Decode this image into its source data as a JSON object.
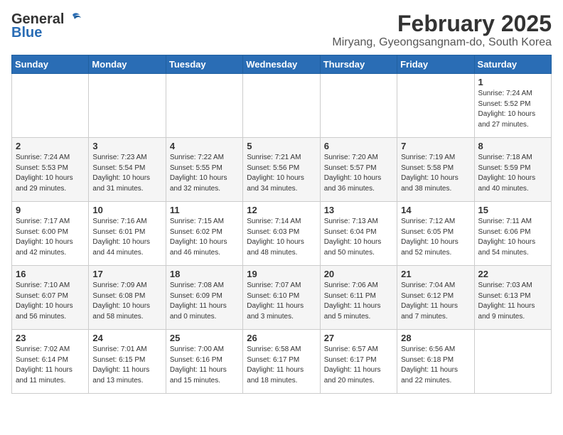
{
  "header": {
    "logo_line1": "General",
    "logo_line2": "Blue",
    "month_title": "February 2025",
    "location": "Miryang, Gyeongsangnam-do, South Korea"
  },
  "weekdays": [
    "Sunday",
    "Monday",
    "Tuesday",
    "Wednesday",
    "Thursday",
    "Friday",
    "Saturday"
  ],
  "weeks": [
    [
      {
        "day": "",
        "sunrise": "",
        "sunset": "",
        "daylight": ""
      },
      {
        "day": "",
        "sunrise": "",
        "sunset": "",
        "daylight": ""
      },
      {
        "day": "",
        "sunrise": "",
        "sunset": "",
        "daylight": ""
      },
      {
        "day": "",
        "sunrise": "",
        "sunset": "",
        "daylight": ""
      },
      {
        "day": "",
        "sunrise": "",
        "sunset": "",
        "daylight": ""
      },
      {
        "day": "",
        "sunrise": "",
        "sunset": "",
        "daylight": ""
      },
      {
        "day": "1",
        "sunrise": "7:24 AM",
        "sunset": "5:52 PM",
        "daylight": "10 hours and 27 minutes."
      }
    ],
    [
      {
        "day": "2",
        "sunrise": "7:24 AM",
        "sunset": "5:53 PM",
        "daylight": "10 hours and 29 minutes."
      },
      {
        "day": "3",
        "sunrise": "7:23 AM",
        "sunset": "5:54 PM",
        "daylight": "10 hours and 31 minutes."
      },
      {
        "day": "4",
        "sunrise": "7:22 AM",
        "sunset": "5:55 PM",
        "daylight": "10 hours and 32 minutes."
      },
      {
        "day": "5",
        "sunrise": "7:21 AM",
        "sunset": "5:56 PM",
        "daylight": "10 hours and 34 minutes."
      },
      {
        "day": "6",
        "sunrise": "7:20 AM",
        "sunset": "5:57 PM",
        "daylight": "10 hours and 36 minutes."
      },
      {
        "day": "7",
        "sunrise": "7:19 AM",
        "sunset": "5:58 PM",
        "daylight": "10 hours and 38 minutes."
      },
      {
        "day": "8",
        "sunrise": "7:18 AM",
        "sunset": "5:59 PM",
        "daylight": "10 hours and 40 minutes."
      }
    ],
    [
      {
        "day": "9",
        "sunrise": "7:17 AM",
        "sunset": "6:00 PM",
        "daylight": "10 hours and 42 minutes."
      },
      {
        "day": "10",
        "sunrise": "7:16 AM",
        "sunset": "6:01 PM",
        "daylight": "10 hours and 44 minutes."
      },
      {
        "day": "11",
        "sunrise": "7:15 AM",
        "sunset": "6:02 PM",
        "daylight": "10 hours and 46 minutes."
      },
      {
        "day": "12",
        "sunrise": "7:14 AM",
        "sunset": "6:03 PM",
        "daylight": "10 hours and 48 minutes."
      },
      {
        "day": "13",
        "sunrise": "7:13 AM",
        "sunset": "6:04 PM",
        "daylight": "10 hours and 50 minutes."
      },
      {
        "day": "14",
        "sunrise": "7:12 AM",
        "sunset": "6:05 PM",
        "daylight": "10 hours and 52 minutes."
      },
      {
        "day": "15",
        "sunrise": "7:11 AM",
        "sunset": "6:06 PM",
        "daylight": "10 hours and 54 minutes."
      }
    ],
    [
      {
        "day": "16",
        "sunrise": "7:10 AM",
        "sunset": "6:07 PM",
        "daylight": "10 hours and 56 minutes."
      },
      {
        "day": "17",
        "sunrise": "7:09 AM",
        "sunset": "6:08 PM",
        "daylight": "10 hours and 58 minutes."
      },
      {
        "day": "18",
        "sunrise": "7:08 AM",
        "sunset": "6:09 PM",
        "daylight": "11 hours and 0 minutes."
      },
      {
        "day": "19",
        "sunrise": "7:07 AM",
        "sunset": "6:10 PM",
        "daylight": "11 hours and 3 minutes."
      },
      {
        "day": "20",
        "sunrise": "7:06 AM",
        "sunset": "6:11 PM",
        "daylight": "11 hours and 5 minutes."
      },
      {
        "day": "21",
        "sunrise": "7:04 AM",
        "sunset": "6:12 PM",
        "daylight": "11 hours and 7 minutes."
      },
      {
        "day": "22",
        "sunrise": "7:03 AM",
        "sunset": "6:13 PM",
        "daylight": "11 hours and 9 minutes."
      }
    ],
    [
      {
        "day": "23",
        "sunrise": "7:02 AM",
        "sunset": "6:14 PM",
        "daylight": "11 hours and 11 minutes."
      },
      {
        "day": "24",
        "sunrise": "7:01 AM",
        "sunset": "6:15 PM",
        "daylight": "11 hours and 13 minutes."
      },
      {
        "day": "25",
        "sunrise": "7:00 AM",
        "sunset": "6:16 PM",
        "daylight": "11 hours and 15 minutes."
      },
      {
        "day": "26",
        "sunrise": "6:58 AM",
        "sunset": "6:17 PM",
        "daylight": "11 hours and 18 minutes."
      },
      {
        "day": "27",
        "sunrise": "6:57 AM",
        "sunset": "6:17 PM",
        "daylight": "11 hours and 20 minutes."
      },
      {
        "day": "28",
        "sunrise": "6:56 AM",
        "sunset": "6:18 PM",
        "daylight": "11 hours and 22 minutes."
      },
      {
        "day": "",
        "sunrise": "",
        "sunset": "",
        "daylight": ""
      }
    ]
  ]
}
